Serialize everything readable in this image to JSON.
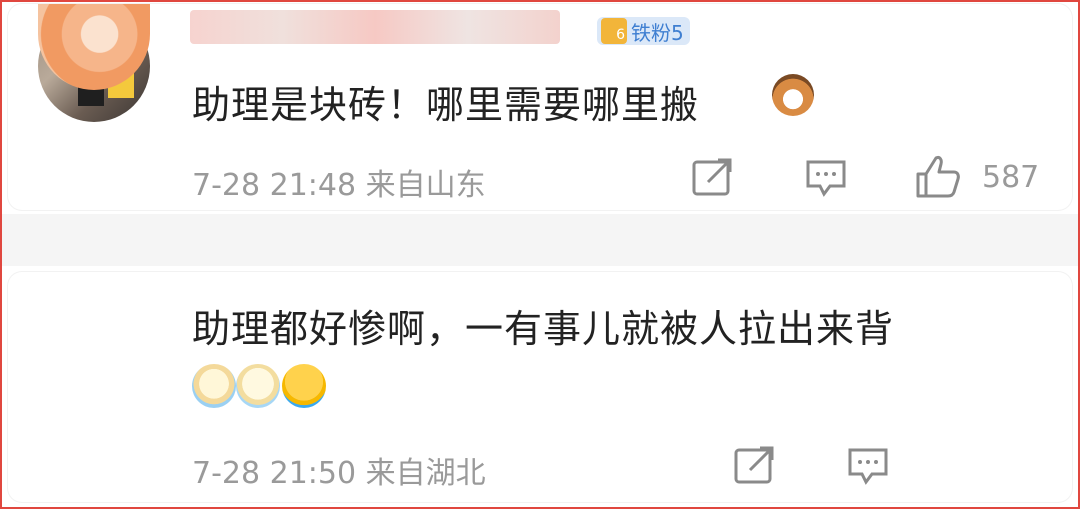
{
  "comments": [
    {
      "fan_badge": {
        "level": "6",
        "label": "铁粉5"
      },
      "text": "助理是块砖！哪里需要哪里搬",
      "emoji": "cat-face-emoji",
      "meta": "7-28 21:48 来自山东",
      "like_count": "587"
    },
    {
      "text": "助理都好惨啊，一有事儿就被人拉出来背",
      "emojis": [
        "crying-emoji",
        "crying-emoji",
        "loudly-crying-emoji"
      ],
      "meta": "7-28 21:50 来自湖北"
    }
  ],
  "colors": {
    "frame": "#e0473f",
    "badge_bg": "#dbe8f8",
    "badge_text": "#3f7fd1",
    "meta": "#9a9a9a"
  }
}
